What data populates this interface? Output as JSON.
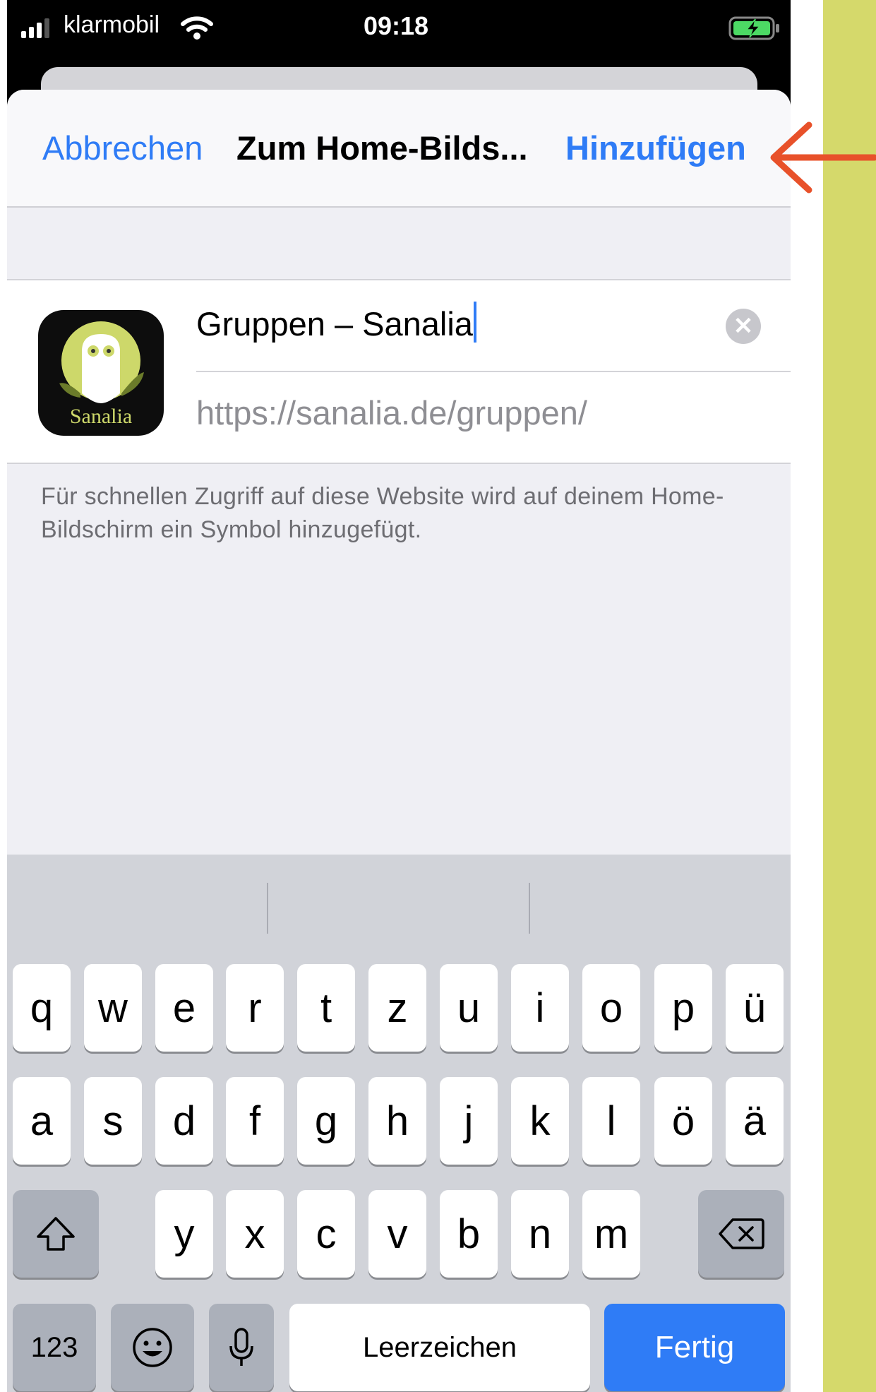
{
  "status_bar": {
    "carrier": "klarmobil",
    "time": "09:18"
  },
  "nav": {
    "cancel_label": "Abbrechen",
    "title": "Zum Home-Bilds...",
    "add_label": "Hinzufügen"
  },
  "form": {
    "icon_label": "Sanalia",
    "name_value": "Gruppen – Sanalia",
    "url_value": "https://sanalia.de/gruppen/"
  },
  "footer_note": "Für schnellen Zugriff auf diese Website wird auf deinem Home-Bildschirm ein Symbol hinzugefügt.",
  "keyboard": {
    "row1": [
      "q",
      "w",
      "e",
      "r",
      "t",
      "z",
      "u",
      "i",
      "o",
      "p",
      "ü"
    ],
    "row2": [
      "a",
      "s",
      "d",
      "f",
      "g",
      "h",
      "j",
      "k",
      "l",
      "ö",
      "ä"
    ],
    "row3": [
      "y",
      "x",
      "c",
      "v",
      "b",
      "n",
      "m"
    ],
    "numbers_label": "123",
    "space_label": "Leerzeichen",
    "done_label": "Fertig"
  },
  "colors": {
    "accent": "#2f7cf6",
    "side_strip": "#d5d96b",
    "arrow": "#e8512a"
  }
}
